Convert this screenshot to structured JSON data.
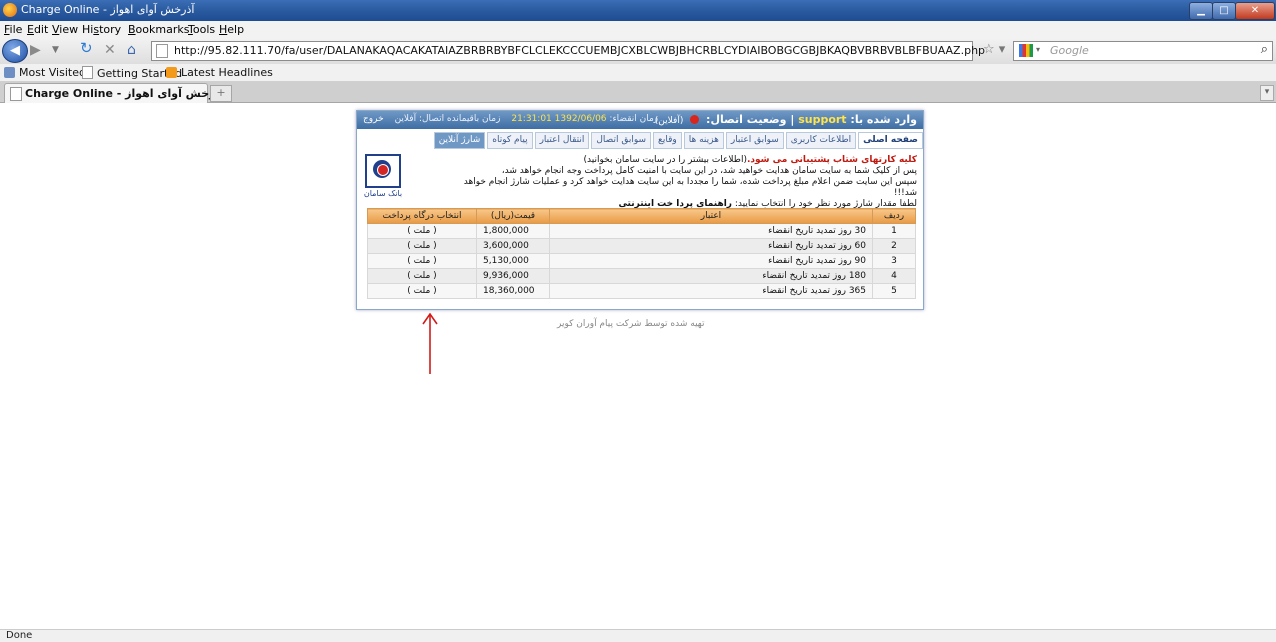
{
  "window": {
    "title": "Charge Online - آذرخش آوای اهواز"
  },
  "menu": [
    "File",
    "Edit",
    "View",
    "History",
    "Bookmarks",
    "Tools",
    "Help"
  ],
  "menu_keys": [
    "F",
    "E",
    "V",
    "s",
    "B",
    "T",
    "H"
  ],
  "address": {
    "url": "http://95.82.111.70/fa/user/DALANAKAQACAKATAIAZBRBRBYBFCLCLEKCCCUEMBJCXBLCWBJBHCRBLCYDIAIBOBGCGBJBKAQBVBRBVBLBFBUAAZ.php"
  },
  "search": {
    "placeholder": "Google"
  },
  "bookmarks": [
    "Most Visited",
    "Getting Started",
    "Latest Headlines"
  ],
  "tab": {
    "label": "Charge Online - آذرخش آوای اهواز"
  },
  "status": {
    "text": "Done"
  },
  "page": {
    "header": {
      "logged_in_label": "وارد شده با:",
      "username": "support",
      "status_label": "| وضعیت اتصال:",
      "status_value": "(آفلاین)",
      "expiry_label": "زمان انقضاء:",
      "expiry_value": "1392/06/06 21:31:01",
      "remaining_label": "زمان باقیمانده اتصال: آفلاین",
      "exit": "خروج"
    },
    "tabs": [
      "صفحه اصلی",
      "اطلاعات کاربری",
      "سوابق اعتبار",
      "هزینه ها",
      "وقایع",
      "سوابق اتصال",
      "انتقال اعتبار",
      "پیام کوتاه",
      "شارژ آنلاین"
    ],
    "info": {
      "line1_red": "کلیه کارتهای شتاب پشتیبانی می شود.",
      "line1_rest": "(اطلاعات بیشتر را در سایت سامان بخوانید)",
      "line2": "پس از کلیک شما به سایت سامان هدایت خواهید شد، در این سایت با امنیت کامل پرداخت وجه انجام خواهد شد،",
      "line3": "سپس این سایت ضمن اعلام مبلغ پرداخت شده، شما را مجددا به این سایت هدایت خواهد کرد و عملیات شارژ انجام خواهد شد!!!",
      "line4": "لطفا مقدار شارژ مورد نظر خود را انتخاب نمایید:",
      "line4_bold": "راهنمای پردا خت اینترنتی"
    },
    "bank_label": "بانک سامان",
    "table": {
      "headers": [
        "ردیف",
        "اعتبار",
        "قیمت(ریال)",
        "انتخاب درگاه پرداخت"
      ],
      "rows": [
        {
          "num": "1",
          "credit": "30 روز تمدید تاریخ انقضاء",
          "price": "1,800,000",
          "gateway": "( ملت )"
        },
        {
          "num": "2",
          "credit": "60 روز تمدید تاریخ انقضاء",
          "price": "3,600,000",
          "gateway": "( ملت )"
        },
        {
          "num": "3",
          "credit": "90 روز تمدید تاریخ انقضاء",
          "price": "5,130,000",
          "gateway": "( ملت )"
        },
        {
          "num": "4",
          "credit": "180 روز تمدید تاریخ انقضاء",
          "price": "9,936,000",
          "gateway": "( ملت )"
        },
        {
          "num": "5",
          "credit": "365 روز تمدید تاریخ انقضاء",
          "price": "18,360,000",
          "gateway": "( ملت )"
        }
      ]
    },
    "footer": "تهیه شده توسط شرکت پیام آوران کویر"
  },
  "colors": {
    "titlebar": "#2a5aa0",
    "panel_header": "#4f7db2",
    "table_header": "#eea552",
    "annotation_arrow": "#d11a1a"
  }
}
